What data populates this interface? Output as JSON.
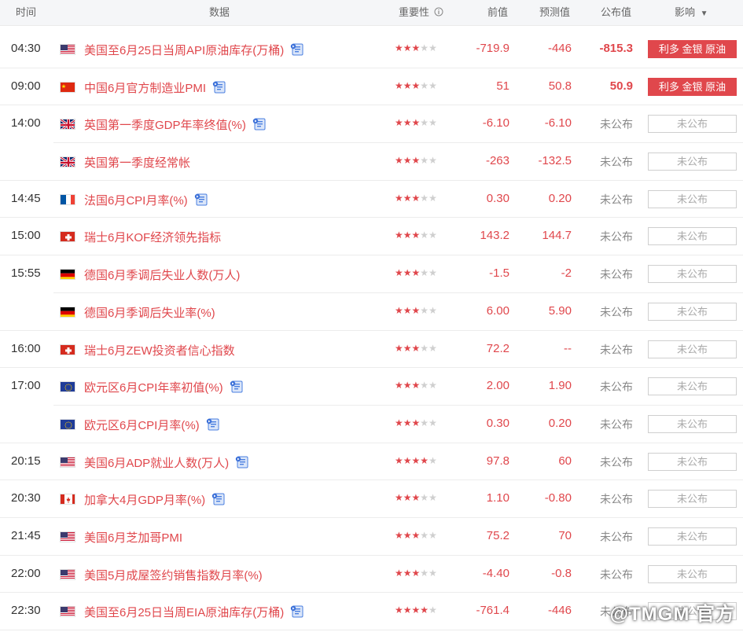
{
  "header": {
    "time": "时间",
    "data": "数据",
    "importance": "重要性",
    "previous": "前值",
    "forecast": "预测值",
    "actual": "公布值",
    "impact": "影响"
  },
  "colors": {
    "accent": "#e0474c",
    "header_bg": "#f5f6f8",
    "pending_gray": "#888888"
  },
  "rows": [
    {
      "time": "04:30",
      "flag": "us",
      "name": "美国至6月25日当周API原油库存(万桶)",
      "doc": true,
      "stars": 3,
      "prev": "-719.9",
      "fcst": "-446",
      "actual": "-815.3",
      "impact": "利多 金银 原油",
      "status": "done"
    },
    {
      "time": "09:00",
      "flag": "cn",
      "name": "中国6月官方制造业PMI",
      "doc": true,
      "stars": 3,
      "prev": "51",
      "fcst": "50.8",
      "actual": "50.9",
      "impact": "利多 金银 原油",
      "status": "done"
    },
    {
      "time": "14:00",
      "flag": "gb",
      "name": "英国第一季度GDP年率终值(%)",
      "doc": true,
      "stars": 3,
      "prev": "-6.10",
      "fcst": "-6.10",
      "actual": "未公布",
      "impact": "未公布",
      "status": "pending"
    },
    {
      "time": "",
      "flag": "gb",
      "name": "英国第一季度经常帐",
      "doc": false,
      "stars": 3,
      "prev": "-263",
      "fcst": "-132.5",
      "actual": "未公布",
      "impact": "未公布",
      "status": "pending"
    },
    {
      "time": "14:45",
      "flag": "fr",
      "name": "法国6月CPI月率(%)",
      "doc": true,
      "stars": 3,
      "prev": "0.30",
      "fcst": "0.20",
      "actual": "未公布",
      "impact": "未公布",
      "status": "pending"
    },
    {
      "time": "15:00",
      "flag": "ch",
      "name": "瑞士6月KOF经济领先指标",
      "doc": false,
      "stars": 3,
      "prev": "143.2",
      "fcst": "144.7",
      "actual": "未公布",
      "impact": "未公布",
      "status": "pending"
    },
    {
      "time": "15:55",
      "flag": "de",
      "name": "德国6月季调后失业人数(万人)",
      "doc": false,
      "stars": 3,
      "prev": "-1.5",
      "fcst": "-2",
      "actual": "未公布",
      "impact": "未公布",
      "status": "pending"
    },
    {
      "time": "",
      "flag": "de",
      "name": "德国6月季调后失业率(%)",
      "doc": false,
      "stars": 3,
      "prev": "6.00",
      "fcst": "5.90",
      "actual": "未公布",
      "impact": "未公布",
      "status": "pending"
    },
    {
      "time": "16:00",
      "flag": "ch",
      "name": "瑞士6月ZEW投资者信心指数",
      "doc": false,
      "stars": 3,
      "prev": "72.2",
      "fcst": "--",
      "actual": "未公布",
      "impact": "未公布",
      "status": "pending"
    },
    {
      "time": "17:00",
      "flag": "eu",
      "name": "欧元区6月CPI年率初值(%)",
      "doc": true,
      "stars": 3,
      "prev": "2.00",
      "fcst": "1.90",
      "actual": "未公布",
      "impact": "未公布",
      "status": "pending"
    },
    {
      "time": "",
      "flag": "eu",
      "name": "欧元区6月CPI月率(%)",
      "doc": true,
      "stars": 3,
      "prev": "0.30",
      "fcst": "0.20",
      "actual": "未公布",
      "impact": "未公布",
      "status": "pending"
    },
    {
      "time": "20:15",
      "flag": "us",
      "name": "美国6月ADP就业人数(万人)",
      "doc": true,
      "stars": 4,
      "prev": "97.8",
      "fcst": "60",
      "actual": "未公布",
      "impact": "未公布",
      "status": "pending"
    },
    {
      "time": "20:30",
      "flag": "ca",
      "name": "加拿大4月GDP月率(%)",
      "doc": true,
      "stars": 3,
      "prev": "1.10",
      "fcst": "-0.80",
      "actual": "未公布",
      "impact": "未公布",
      "status": "pending"
    },
    {
      "time": "21:45",
      "flag": "us",
      "name": "美国6月芝加哥PMI",
      "doc": false,
      "stars": 3,
      "prev": "75.2",
      "fcst": "70",
      "actual": "未公布",
      "impact": "未公布",
      "status": "pending"
    },
    {
      "time": "22:00",
      "flag": "us",
      "name": "美国5月成屋签约销售指数月率(%)",
      "doc": false,
      "stars": 3,
      "prev": "-4.40",
      "fcst": "-0.8",
      "actual": "未公布",
      "impact": "未公布",
      "status": "pending"
    },
    {
      "time": "22:30",
      "flag": "us",
      "name": "美国至6月25日当周EIA原油库存(万桶)",
      "doc": true,
      "stars": 4,
      "prev": "-761.4",
      "fcst": "-446",
      "actual": "未公布",
      "impact": "未公布",
      "status": "pending"
    }
  ],
  "watermark": "@TMGM 官方"
}
